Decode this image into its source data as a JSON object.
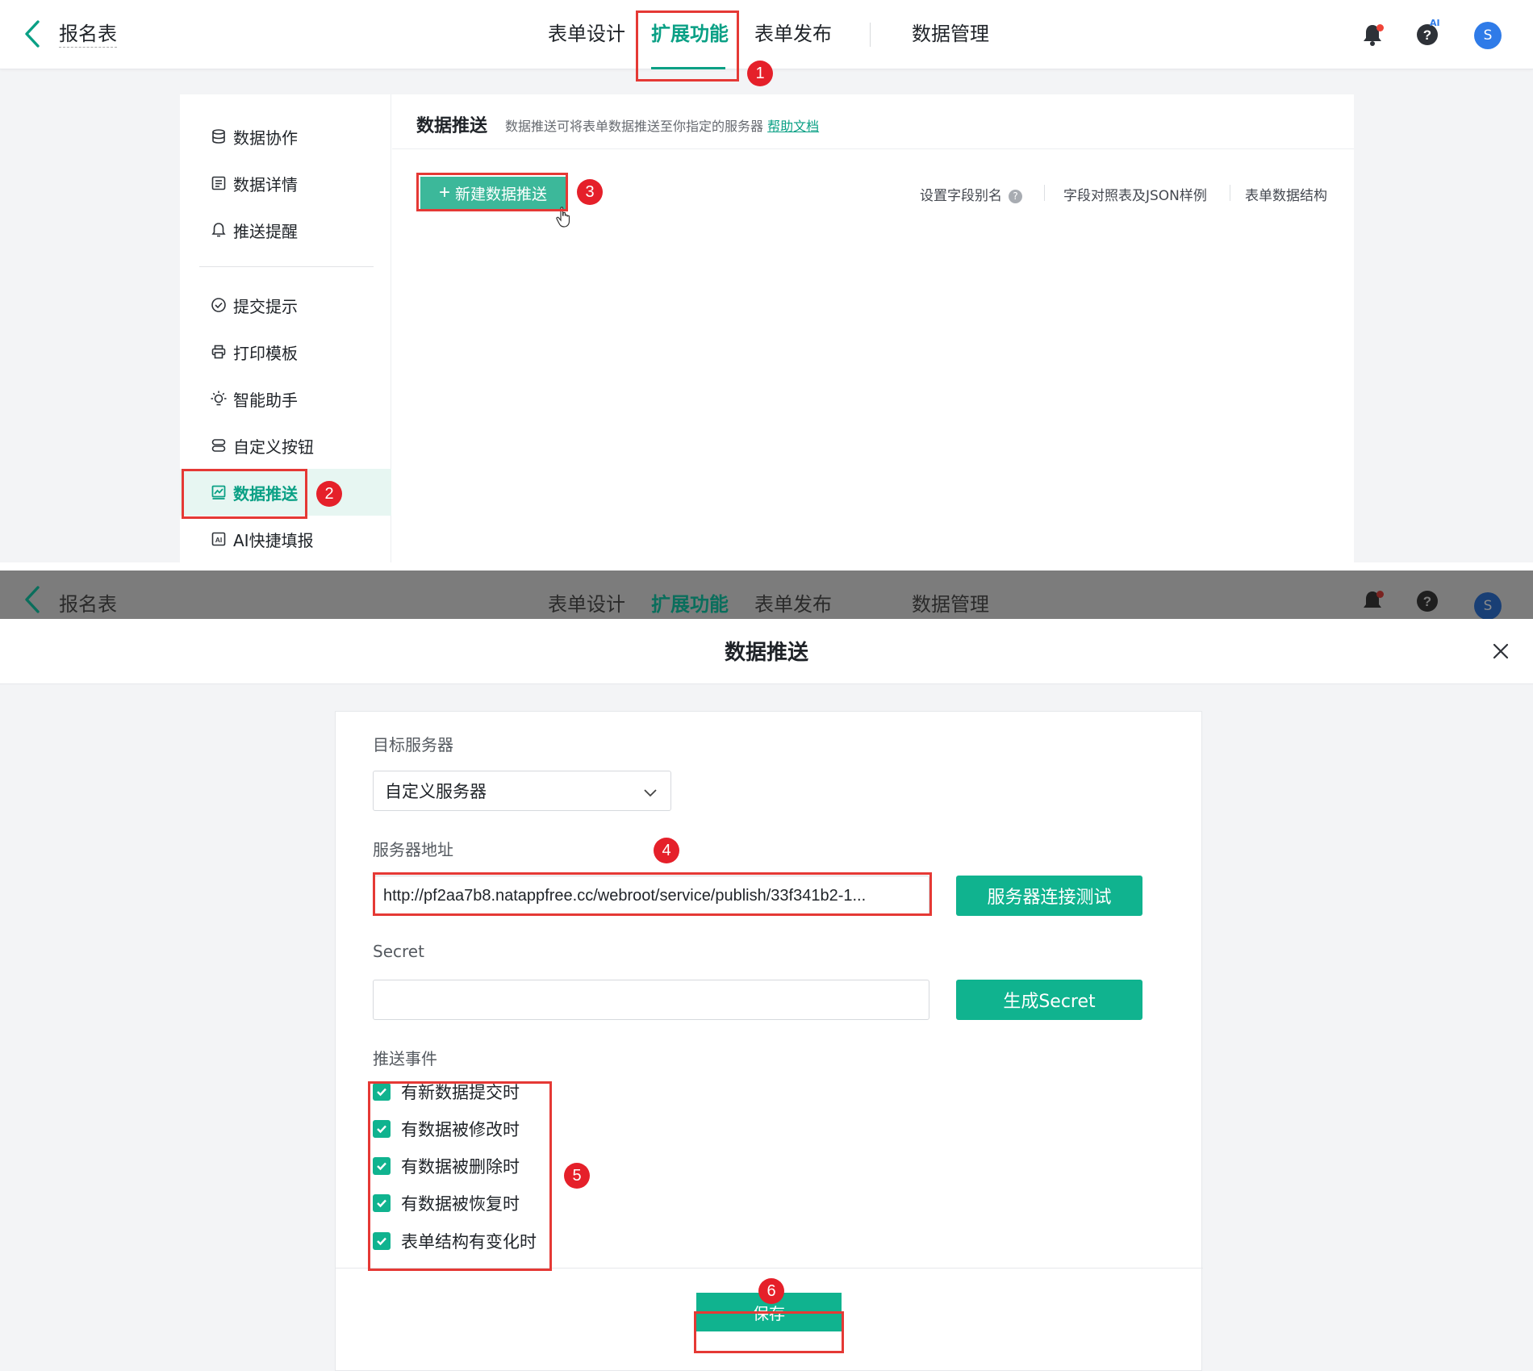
{
  "app": {
    "form_title": "报名表",
    "nav_tabs": [
      "表单设计",
      "扩展功能",
      "表单发布",
      "数据管理"
    ],
    "active_tab": "扩展功能",
    "avatar_initial": "S",
    "ai_badge": "AI"
  },
  "sidebar": {
    "items": [
      {
        "label": "数据协作",
        "icon": "database-icon"
      },
      {
        "label": "数据详情",
        "icon": "document-list-icon"
      },
      {
        "label": "推送提醒",
        "icon": "bell-icon"
      },
      {
        "label": "提交提示",
        "icon": "check-circle-icon"
      },
      {
        "label": "打印模板",
        "icon": "printer-icon"
      },
      {
        "label": "智能助手",
        "icon": "lightbulb-icon"
      },
      {
        "label": "自定义按钮",
        "icon": "button-stack-icon"
      },
      {
        "label": "数据推送",
        "icon": "chart-box-icon"
      },
      {
        "label": "AI快捷填报",
        "icon": "ai-box-icon"
      }
    ],
    "active_item": "数据推送"
  },
  "main": {
    "title": "数据推送",
    "description": "数据推送可将表单数据推送至你指定的服务器",
    "help_link": "帮助文档",
    "new_button": "新建数据推送",
    "links": [
      "设置字段别名",
      "字段对照表及JSON样例",
      "表单数据结构"
    ],
    "help_glyph": "?"
  },
  "modal": {
    "title": "数据推送",
    "target_server_label": "目标服务器",
    "target_server_value": "自定义服务器",
    "server_address_label": "服务器地址",
    "server_address_value": "http://pf2aa7b8.natappfree.cc/webroot/service/publish/33f341b2-1...",
    "test_button": "服务器连接测试",
    "secret_label": "Secret",
    "secret_value": "",
    "generate_button": "生成Secret",
    "events_label": "推送事件",
    "events": [
      "有新数据提交时",
      "有数据被修改时",
      "有数据被删除时",
      "有数据被恢复时",
      "表单结构有变化时"
    ],
    "save_button": "保存"
  },
  "annotations": [
    "1",
    "2",
    "3",
    "4",
    "5",
    "6"
  ],
  "colors": {
    "accent": "#0aa085",
    "button_green": "#10b38f",
    "annotation_red": "#e53935",
    "avatar_blue": "#2f7be8"
  }
}
